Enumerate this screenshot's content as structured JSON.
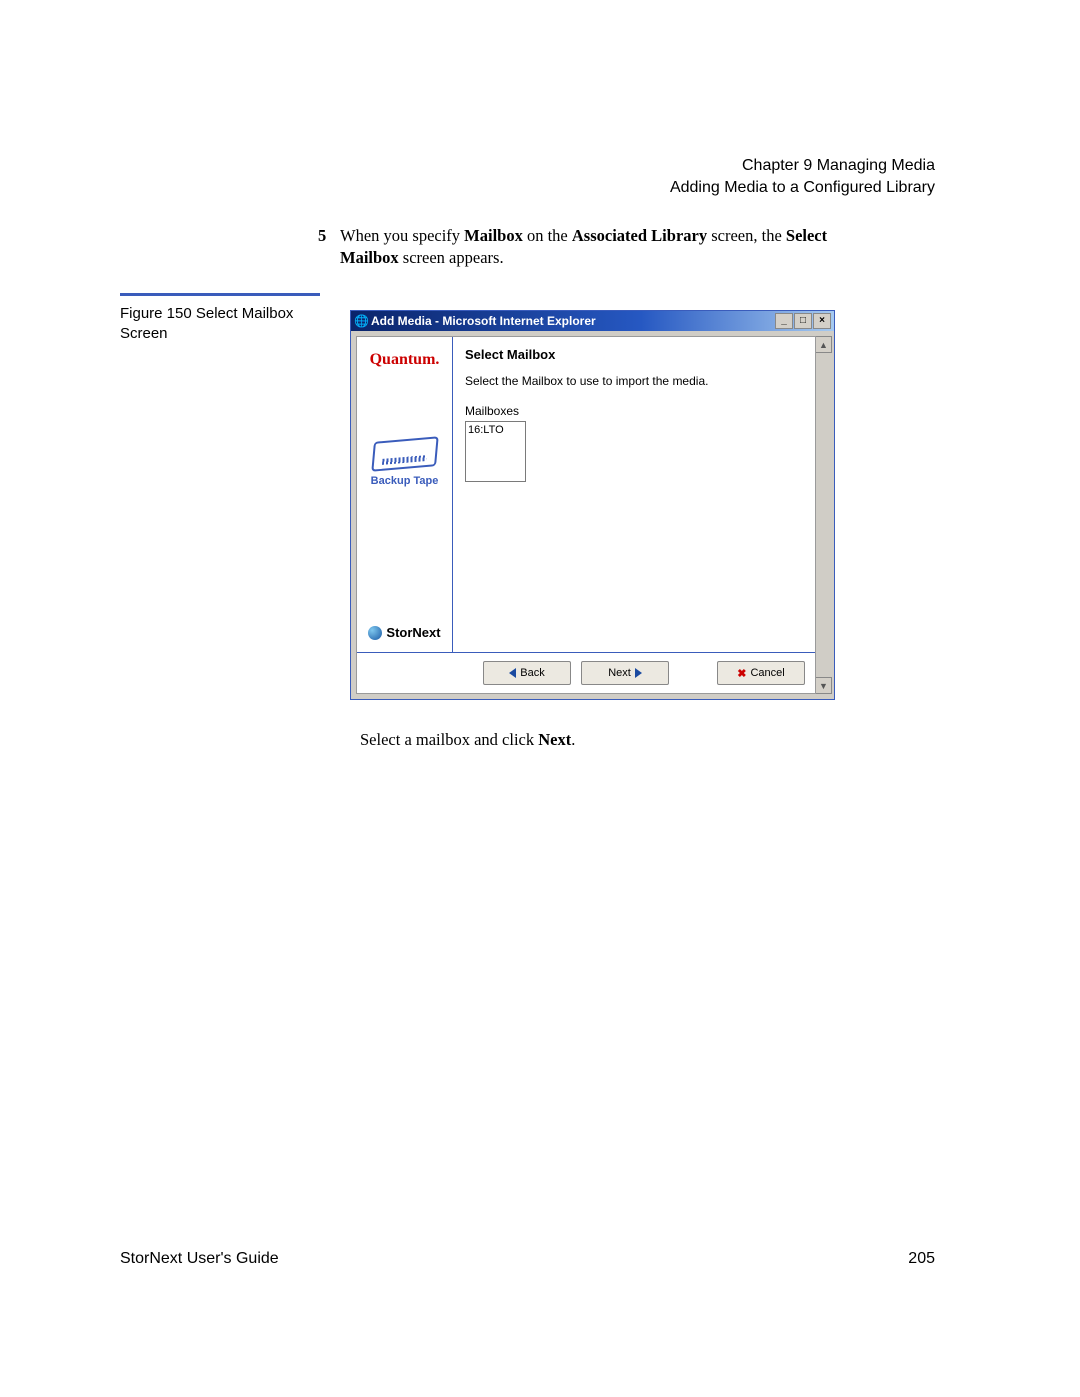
{
  "header": {
    "chapter": "Chapter 9  Managing Media",
    "section": "Adding Media to a Configured Library"
  },
  "step": {
    "number": "5",
    "text_prefix": "When you specify ",
    "bold1": "Mailbox",
    "text_mid1": " on the ",
    "bold2": "Associated Library",
    "text_mid2": " screen, the ",
    "bold3": "Select Mailbox",
    "text_suffix": " screen appears."
  },
  "figure_caption": "Figure 150  Select Mailbox Screen",
  "window": {
    "title": "Add Media - Microsoft Internet Explorer",
    "sidebar": {
      "brand": "Quantum.",
      "tape_label": "Backup Tape",
      "product": "StorNext"
    },
    "main": {
      "heading": "Select Mailbox",
      "instruction": "Select the Mailbox to use to import the media.",
      "list_label": "Mailboxes",
      "list_item": "16:LTO"
    },
    "buttons": {
      "back": "Back",
      "next": "Next",
      "cancel": "Cancel"
    }
  },
  "post_step": {
    "prefix": "Select a mailbox and click ",
    "bold": "Next",
    "suffix": "."
  },
  "footer": {
    "guide": "StorNext User's Guide",
    "page": "205"
  }
}
